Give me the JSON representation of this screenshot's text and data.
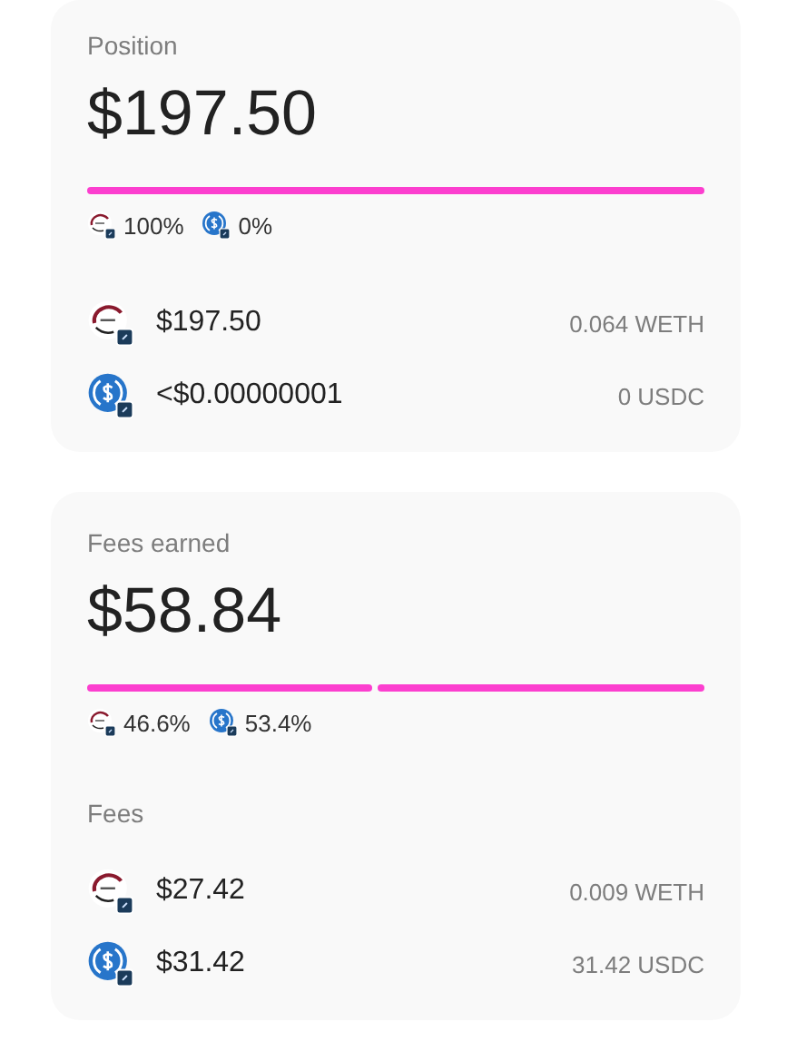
{
  "cards": [
    {
      "label": "Position",
      "value": "$197.50",
      "shares": [
        {
          "kind": "weth",
          "percent": "100%"
        },
        {
          "kind": "usdc",
          "percent": "0%"
        }
      ],
      "rows": [
        {
          "kind": "weth",
          "usd": "$197.50",
          "amount": "0.064 WETH"
        },
        {
          "kind": "usdc",
          "usd": "<$0.00000001",
          "amount": "0 USDC"
        }
      ]
    },
    {
      "label": "Fees earned",
      "value": "$58.84",
      "shares": [
        {
          "kind": "weth",
          "percent": "46.6%"
        },
        {
          "kind": "usdc",
          "percent": "53.4%"
        }
      ],
      "subheading": "Fees",
      "rows": [
        {
          "kind": "weth",
          "usd": "$27.42",
          "amount": "0.009 WETH"
        },
        {
          "kind": "usdc",
          "usd": "$31.42",
          "amount": "31.42 USDC"
        }
      ]
    }
  ]
}
